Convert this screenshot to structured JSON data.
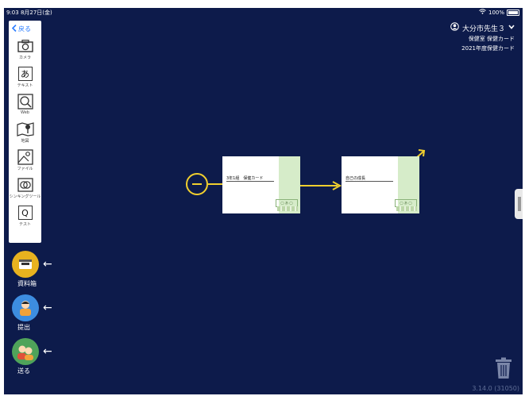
{
  "status": {
    "time_date": "9:03  8月27日(金)",
    "battery": "100%"
  },
  "toolbar": {
    "back": "戻る",
    "tools": [
      {
        "label": "カメラ",
        "icon": "camera-icon"
      },
      {
        "label": "テキスト",
        "icon": "text-icon",
        "glyph": "あ"
      },
      {
        "label": "Web",
        "icon": "web-search-icon"
      },
      {
        "label": "地図",
        "icon": "map-icon"
      },
      {
        "label": "ファイル",
        "icon": "file-image-icon"
      },
      {
        "label": "シンキングツール",
        "icon": "thinking-tool-icon"
      },
      {
        "label": "テスト",
        "icon": "test-icon",
        "glyph": "Q"
      }
    ]
  },
  "left_buttons": [
    {
      "label": "資料箱",
      "icon": "document-box-icon",
      "color": "#e8b21f"
    },
    {
      "label": "提出",
      "icon": "submit-person-icon",
      "color": "#3d8de0"
    },
    {
      "label": "送る",
      "icon": "send-people-icon",
      "color": "#4fa35a"
    }
  ],
  "user": {
    "name": "大分市先生３",
    "line1": "保健室 保健カード",
    "line2": "2021年度保健カード"
  },
  "cards": [
    {
      "title": "3年1組　保健カード",
      "stamp": "◯ あ ◯"
    },
    {
      "title": "自己の成長",
      "stamp": "◯ あ ◯"
    }
  ],
  "footer": {
    "version": "3.14.0 (31050)"
  },
  "colors": {
    "background": "#0d1b4b",
    "accent_yellow": "#f1cf2e",
    "link_blue": "#2a7cff"
  }
}
